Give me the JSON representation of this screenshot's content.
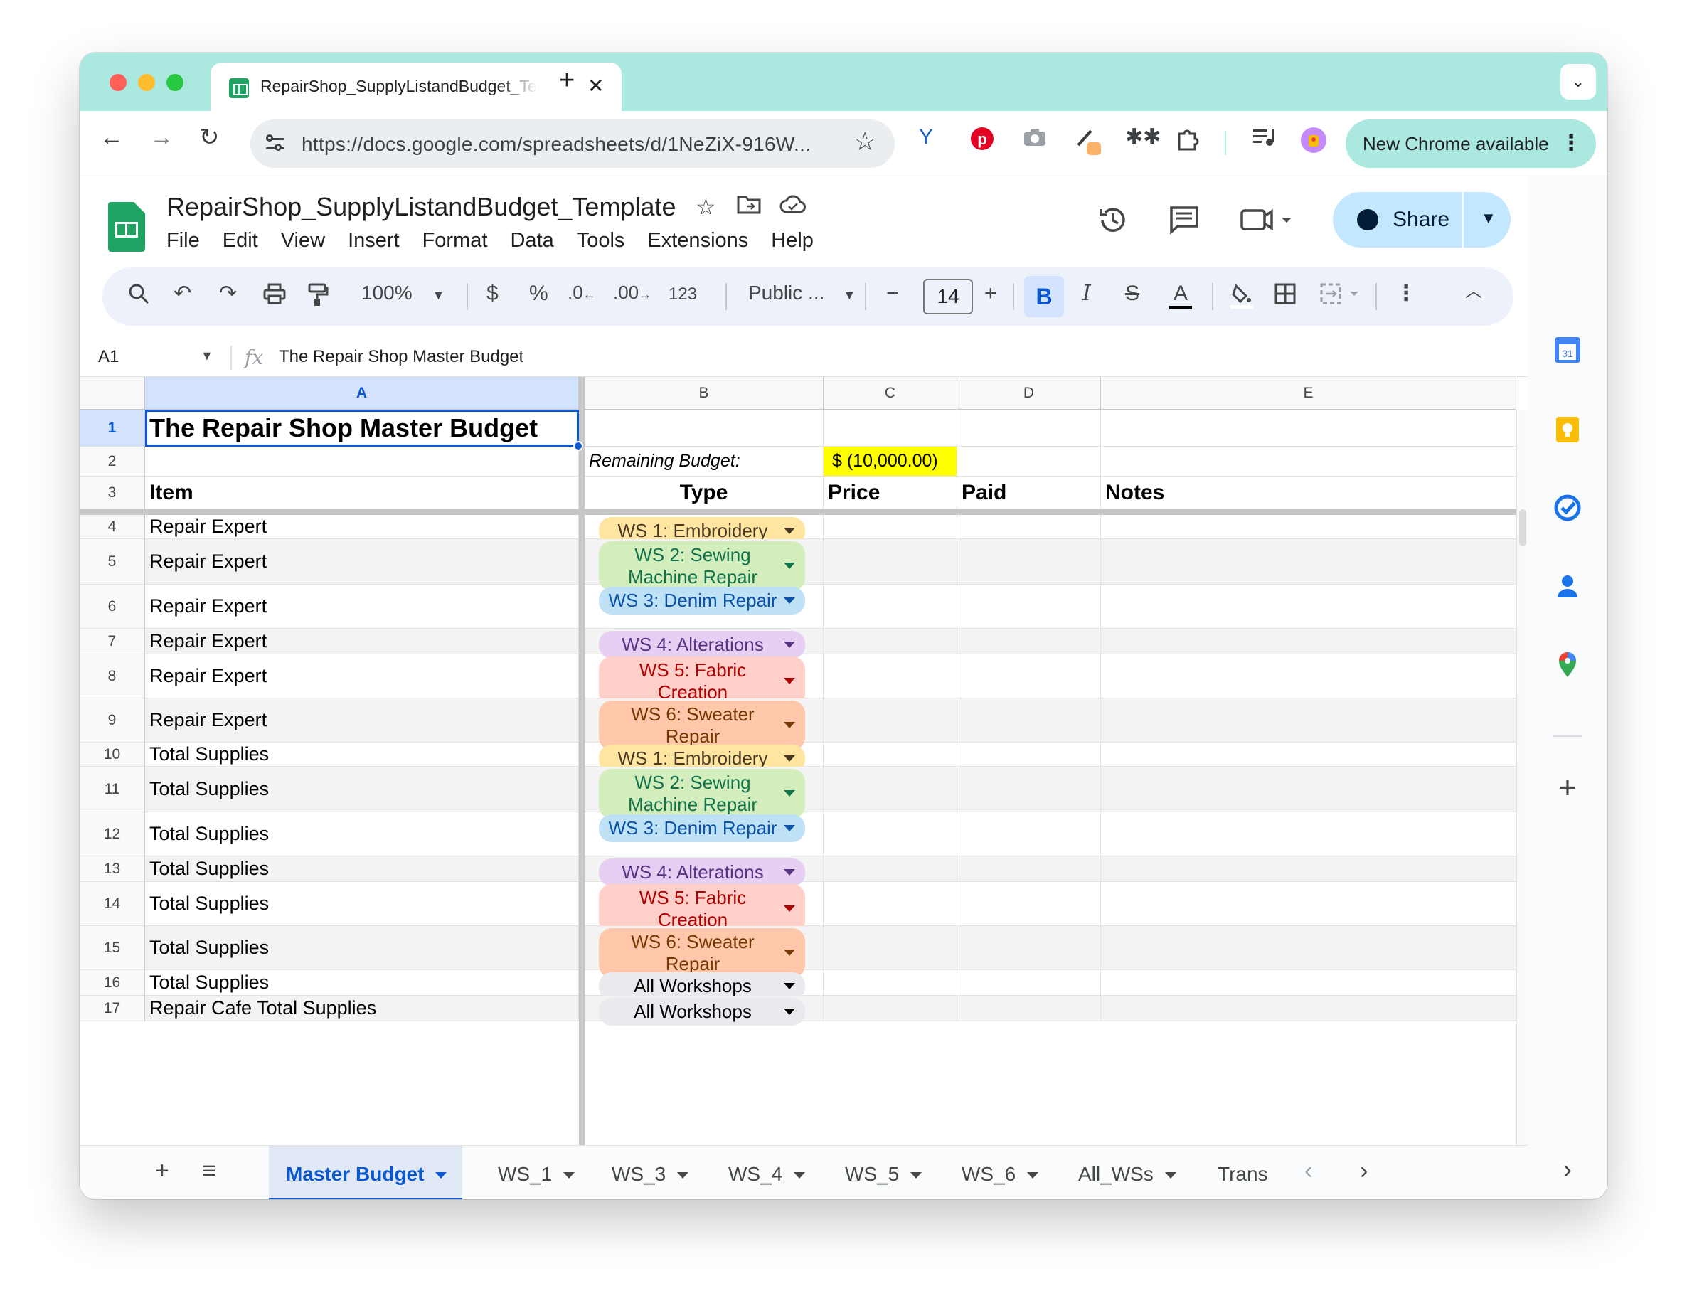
{
  "browser": {
    "tab_title": "RepairShop_SupplyListandBudget_Template",
    "url": "https://docs.google.com/spreadsheets/d/1NeZiX-916W...",
    "new_chrome_label": "New Chrome available"
  },
  "sheets": {
    "doc_title": "RepairShop_SupplyListandBudget_Template",
    "menu": [
      "File",
      "Edit",
      "View",
      "Insert",
      "Format",
      "Data",
      "Tools",
      "Extensions",
      "Help"
    ],
    "share_label": "Share",
    "toolbar": {
      "zoom": "100%",
      "currency": "$",
      "percent": "%",
      "dec_decrease": ".0",
      "dec_increase": ".00",
      "number_format": "123",
      "font": "Public ...",
      "font_size": "14",
      "bold": "B",
      "italic": "I",
      "text_color": "A"
    },
    "formula_bar": {
      "cell_ref": "A1",
      "fx": "fx",
      "content": "The Repair Shop Master Budget"
    },
    "columns": [
      "A",
      "B",
      "C",
      "D",
      "E"
    ],
    "rows": [
      {
        "num": "1",
        "a": "The Repair Shop Master Budget"
      },
      {
        "num": "2",
        "b": "Remaining Budget:",
        "c": "$ (10,000.00)"
      },
      {
        "num": "3",
        "a": "Item",
        "b": "Type",
        "c": "Price",
        "d": "Paid",
        "e": "Notes"
      },
      {
        "num": "4",
        "a": "Repair Expert",
        "chip": "WS 1: Embroidery"
      },
      {
        "num": "5",
        "a": "Repair Expert",
        "chip": "WS 2: Sewing Machine Repair"
      },
      {
        "num": "6",
        "a": "Repair Expert",
        "chip": "WS 3: Denim Repair"
      },
      {
        "num": "7",
        "a": "Repair Expert",
        "chip": "WS 4: Alterations"
      },
      {
        "num": "8",
        "a": "Repair Expert",
        "chip": "WS 5: Fabric Creation"
      },
      {
        "num": "9",
        "a": "Repair Expert",
        "chip": "WS 6: Sweater Repair"
      },
      {
        "num": "10",
        "a": "Total Supplies",
        "chip": "WS 1: Embroidery"
      },
      {
        "num": "11",
        "a": "Total Supplies",
        "chip": "WS 2: Sewing Machine Repair"
      },
      {
        "num": "12",
        "a": "Total Supplies",
        "chip": "WS 3: Denim Repair"
      },
      {
        "num": "13",
        "a": "Total Supplies",
        "chip": "WS 4: Alterations"
      },
      {
        "num": "14",
        "a": "Total Supplies",
        "chip": "WS 5: Fabric Creation"
      },
      {
        "num": "15",
        "a": "Total Supplies",
        "chip": "WS 6: Sweater Repair"
      },
      {
        "num": "16",
        "a": "Total Supplies",
        "chip": "All Workshops"
      },
      {
        "num": "17",
        "a": "Repair Cafe Total Supplies",
        "chip": "All Workshops"
      }
    ],
    "sheet_tabs": [
      "Master Budget",
      "WS_1",
      "WS_3",
      "WS_4",
      "WS_5",
      "WS_6",
      "All_WSs",
      "Trans"
    ]
  },
  "colors": {
    "accent": "#0b57d0",
    "chrome_frame": "#abe8e0",
    "highlight_cell": "#ffff00"
  }
}
